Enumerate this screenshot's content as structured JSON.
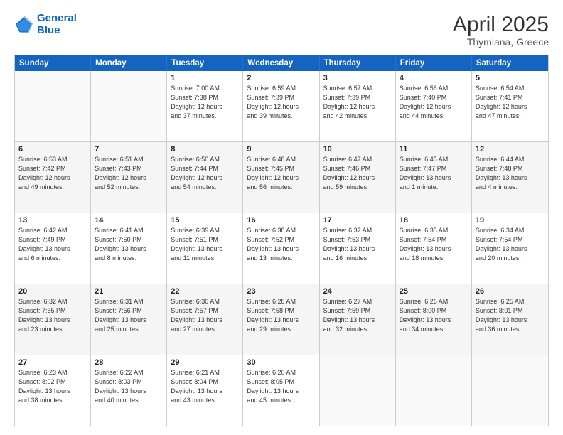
{
  "header": {
    "logo_line1": "General",
    "logo_line2": "Blue",
    "title": "April 2025",
    "subtitle": "Thymiana, Greece"
  },
  "days_of_week": [
    "Sunday",
    "Monday",
    "Tuesday",
    "Wednesday",
    "Thursday",
    "Friday",
    "Saturday"
  ],
  "weeks": [
    {
      "alt": false,
      "cells": [
        {
          "empty": true
        },
        {
          "empty": true
        },
        {
          "day": "1",
          "info": "Sunrise: 7:00 AM\nSunset: 7:38 PM\nDaylight: 12 hours\nand 37 minutes."
        },
        {
          "day": "2",
          "info": "Sunrise: 6:59 AM\nSunset: 7:39 PM\nDaylight: 12 hours\nand 39 minutes."
        },
        {
          "day": "3",
          "info": "Sunrise: 6:57 AM\nSunset: 7:39 PM\nDaylight: 12 hours\nand 42 minutes."
        },
        {
          "day": "4",
          "info": "Sunrise: 6:56 AM\nSunset: 7:40 PM\nDaylight: 12 hours\nand 44 minutes."
        },
        {
          "day": "5",
          "info": "Sunrise: 6:54 AM\nSunset: 7:41 PM\nDaylight: 12 hours\nand 47 minutes."
        }
      ]
    },
    {
      "alt": true,
      "cells": [
        {
          "day": "6",
          "info": "Sunrise: 6:53 AM\nSunset: 7:42 PM\nDaylight: 12 hours\nand 49 minutes."
        },
        {
          "day": "7",
          "info": "Sunrise: 6:51 AM\nSunset: 7:43 PM\nDaylight: 12 hours\nand 52 minutes."
        },
        {
          "day": "8",
          "info": "Sunrise: 6:50 AM\nSunset: 7:44 PM\nDaylight: 12 hours\nand 54 minutes."
        },
        {
          "day": "9",
          "info": "Sunrise: 6:48 AM\nSunset: 7:45 PM\nDaylight: 12 hours\nand 56 minutes."
        },
        {
          "day": "10",
          "info": "Sunrise: 6:47 AM\nSunset: 7:46 PM\nDaylight: 12 hours\nand 59 minutes."
        },
        {
          "day": "11",
          "info": "Sunrise: 6:45 AM\nSunset: 7:47 PM\nDaylight: 13 hours\nand 1 minute."
        },
        {
          "day": "12",
          "info": "Sunrise: 6:44 AM\nSunset: 7:48 PM\nDaylight: 13 hours\nand 4 minutes."
        }
      ]
    },
    {
      "alt": false,
      "cells": [
        {
          "day": "13",
          "info": "Sunrise: 6:42 AM\nSunset: 7:49 PM\nDaylight: 13 hours\nand 6 minutes."
        },
        {
          "day": "14",
          "info": "Sunrise: 6:41 AM\nSunset: 7:50 PM\nDaylight: 13 hours\nand 8 minutes."
        },
        {
          "day": "15",
          "info": "Sunrise: 6:39 AM\nSunset: 7:51 PM\nDaylight: 13 hours\nand 11 minutes."
        },
        {
          "day": "16",
          "info": "Sunrise: 6:38 AM\nSunset: 7:52 PM\nDaylight: 13 hours\nand 13 minutes."
        },
        {
          "day": "17",
          "info": "Sunrise: 6:37 AM\nSunset: 7:53 PM\nDaylight: 13 hours\nand 16 minutes."
        },
        {
          "day": "18",
          "info": "Sunrise: 6:35 AM\nSunset: 7:54 PM\nDaylight: 13 hours\nand 18 minutes."
        },
        {
          "day": "19",
          "info": "Sunrise: 6:34 AM\nSunset: 7:54 PM\nDaylight: 13 hours\nand 20 minutes."
        }
      ]
    },
    {
      "alt": true,
      "cells": [
        {
          "day": "20",
          "info": "Sunrise: 6:32 AM\nSunset: 7:55 PM\nDaylight: 13 hours\nand 23 minutes."
        },
        {
          "day": "21",
          "info": "Sunrise: 6:31 AM\nSunset: 7:56 PM\nDaylight: 13 hours\nand 25 minutes."
        },
        {
          "day": "22",
          "info": "Sunrise: 6:30 AM\nSunset: 7:57 PM\nDaylight: 13 hours\nand 27 minutes."
        },
        {
          "day": "23",
          "info": "Sunrise: 6:28 AM\nSunset: 7:58 PM\nDaylight: 13 hours\nand 29 minutes."
        },
        {
          "day": "24",
          "info": "Sunrise: 6:27 AM\nSunset: 7:59 PM\nDaylight: 13 hours\nand 32 minutes."
        },
        {
          "day": "25",
          "info": "Sunrise: 6:26 AM\nSunset: 8:00 PM\nDaylight: 13 hours\nand 34 minutes."
        },
        {
          "day": "26",
          "info": "Sunrise: 6:25 AM\nSunset: 8:01 PM\nDaylight: 13 hours\nand 36 minutes."
        }
      ]
    },
    {
      "alt": false,
      "cells": [
        {
          "day": "27",
          "info": "Sunrise: 6:23 AM\nSunset: 8:02 PM\nDaylight: 13 hours\nand 38 minutes."
        },
        {
          "day": "28",
          "info": "Sunrise: 6:22 AM\nSunset: 8:03 PM\nDaylight: 13 hours\nand 40 minutes."
        },
        {
          "day": "29",
          "info": "Sunrise: 6:21 AM\nSunset: 8:04 PM\nDaylight: 13 hours\nand 43 minutes."
        },
        {
          "day": "30",
          "info": "Sunrise: 6:20 AM\nSunset: 8:05 PM\nDaylight: 13 hours\nand 45 minutes."
        },
        {
          "empty": true
        },
        {
          "empty": true
        },
        {
          "empty": true
        }
      ]
    }
  ]
}
